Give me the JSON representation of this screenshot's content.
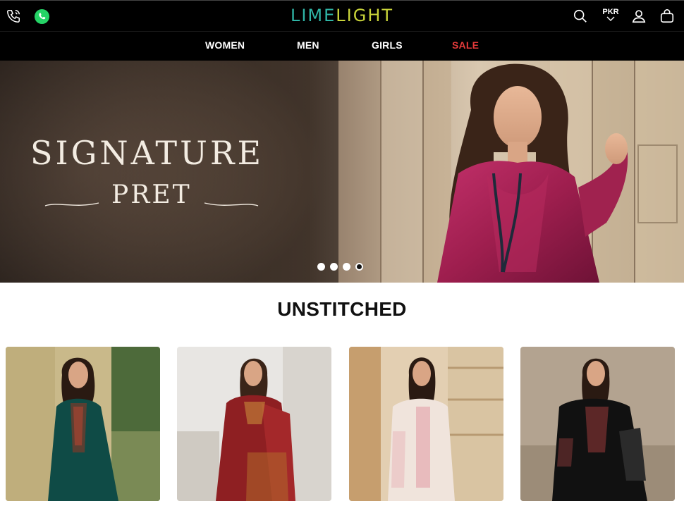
{
  "header": {
    "logo": {
      "part1": "LIM",
      "part2": "E",
      "part3": "LIGHT"
    },
    "currency": "PKR",
    "icons": [
      "phone-icon",
      "whatsapp-icon",
      "search-icon",
      "account-icon",
      "cart-icon"
    ]
  },
  "nav": {
    "items": [
      {
        "label": "WOMEN"
      },
      {
        "label": "MEN"
      },
      {
        "label": "GIRLS"
      },
      {
        "label": "SALE"
      }
    ]
  },
  "hero": {
    "title": "SIGNATURE",
    "subtitle": "PRET",
    "slide_count": 4,
    "active_slide": 4
  },
  "section": {
    "title": "UNSTITCHED"
  },
  "colors": {
    "brand_teal": "#2fb5a6",
    "brand_lime": "#c9d43a",
    "sale_red": "#e43a3a",
    "bar": "#000000"
  }
}
